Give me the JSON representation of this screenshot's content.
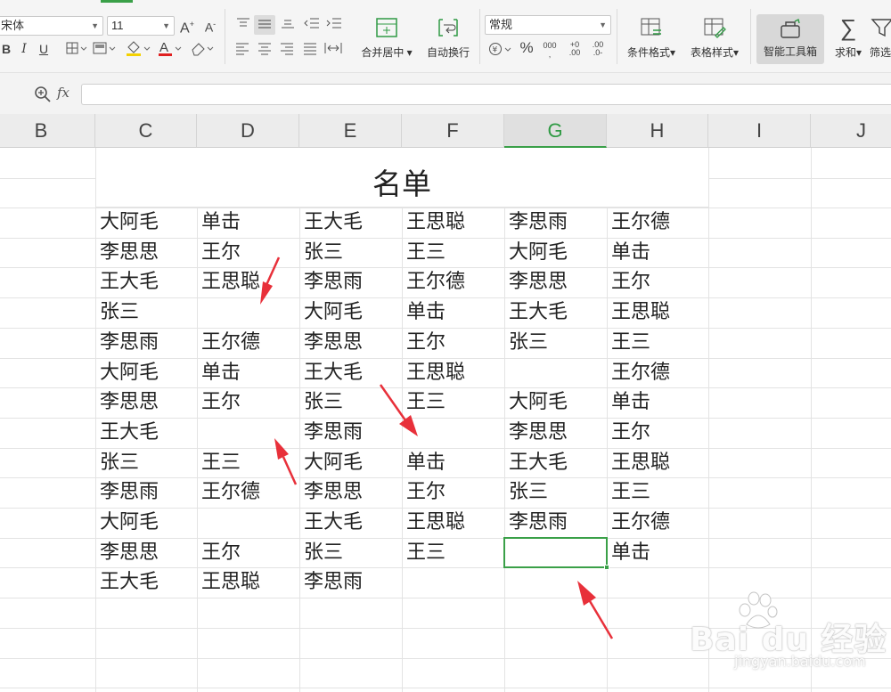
{
  "toolbar": {
    "font_name": "宋体",
    "font_size": "11",
    "merge_center_label": "合并居中",
    "wrap_label": "自动换行",
    "number_format": "常规",
    "cond_format_label": "条件格式",
    "table_style_label": "表格样式",
    "smart_toolbox_label": "智能工具箱",
    "sum_label": "求和",
    "filter_label": "筛选"
  },
  "formula_bar": {
    "fx": "fx",
    "value": ""
  },
  "columns": [
    "B",
    "C",
    "D",
    "E",
    "F",
    "G",
    "H",
    "I",
    "J"
  ],
  "active_column": "G",
  "sheet": {
    "title": "名单",
    "rows": [
      [
        "大阿毛",
        "单击",
        "王大毛",
        "王思聪",
        "李思雨",
        "王尔德"
      ],
      [
        "李思思",
        "王尔",
        "张三",
        "王三",
        "大阿毛",
        "单击"
      ],
      [
        "王大毛",
        "王思聪",
        "李思雨",
        "王尔德",
        "李思思",
        "王尔"
      ],
      [
        "张三",
        "",
        "大阿毛",
        "单击",
        "王大毛",
        "王思聪"
      ],
      [
        "李思雨",
        "王尔德",
        "李思思",
        "王尔",
        "张三",
        "王三"
      ],
      [
        "大阿毛",
        "单击",
        "王大毛",
        "王思聪",
        "",
        "王尔德"
      ],
      [
        "李思思",
        "王尔",
        "张三",
        "王三",
        "大阿毛",
        "单击"
      ],
      [
        "王大毛",
        "",
        "李思雨",
        "",
        "李思思",
        "王尔"
      ],
      [
        "张三",
        "王三",
        "大阿毛",
        "单击",
        "王大毛",
        "王思聪"
      ],
      [
        "李思雨",
        "王尔德",
        "李思思",
        "王尔",
        "张三",
        "王三"
      ],
      [
        "大阿毛",
        "",
        "王大毛",
        "王思聪",
        "李思雨",
        "王尔德"
      ],
      [
        "李思思",
        "王尔",
        "张三",
        "王三",
        "",
        "单击"
      ],
      [
        "王大毛",
        "王思聪",
        "李思雨",
        "",
        "",
        ""
      ]
    ]
  },
  "colors": {
    "accent": "#3aa048",
    "arrow": "#e8303a"
  },
  "watermark": {
    "main": "Bai du 经验",
    "sub": "jingyan.baidu.com"
  }
}
